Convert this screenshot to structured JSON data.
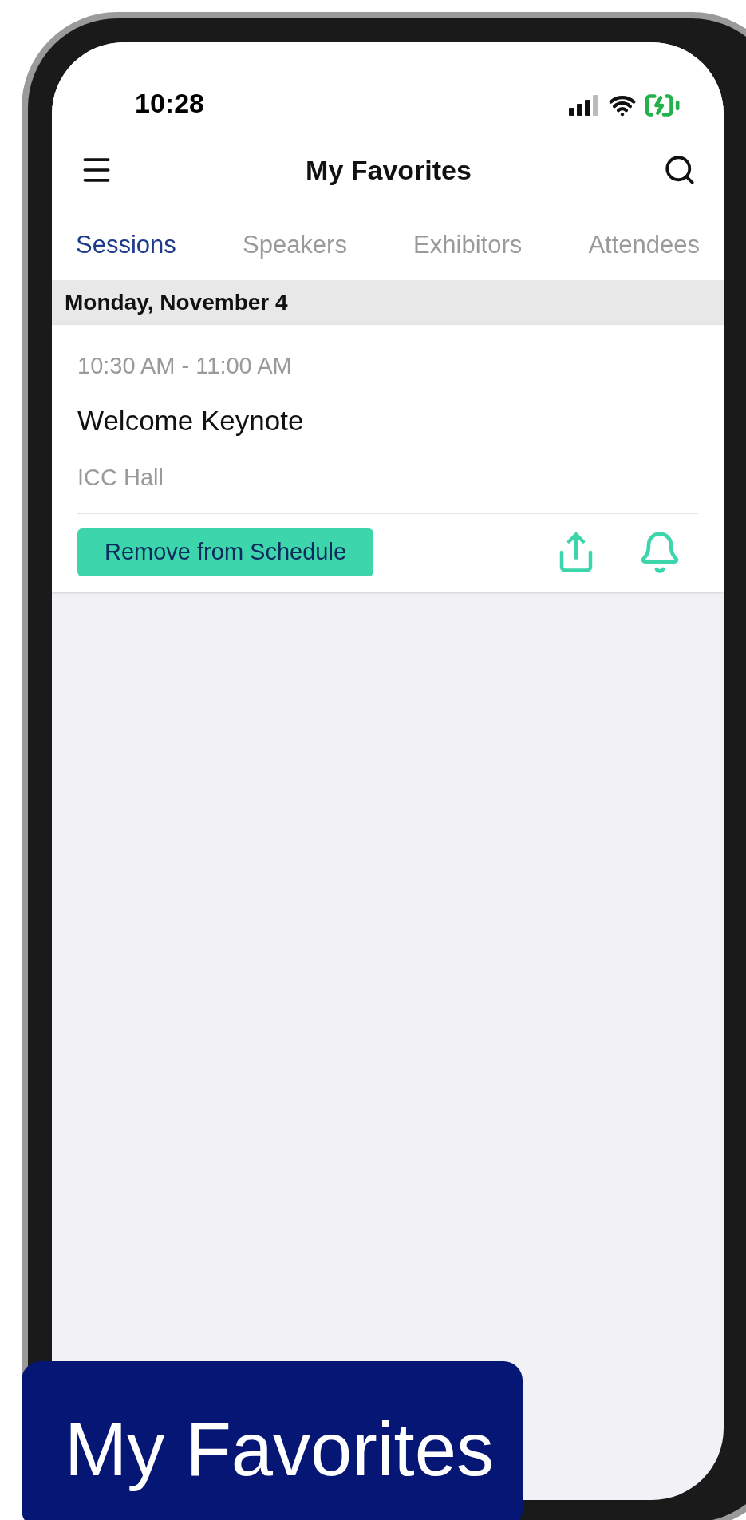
{
  "status_bar": {
    "time": "10:28"
  },
  "header": {
    "title": "My Favorites"
  },
  "tabs": [
    {
      "label": "Sessions",
      "selected": true
    },
    {
      "label": "Speakers",
      "selected": false
    },
    {
      "label": "Exhibitors",
      "selected": false
    },
    {
      "label": "Attendees",
      "selected": false
    }
  ],
  "sections": [
    {
      "date": "Monday, November 4",
      "sessions": [
        {
          "time": "10:30 AM - 11:00 AM",
          "title": "Welcome Keynote",
          "location": "ICC Hall",
          "action": "Remove from Schedule"
        }
      ]
    }
  ],
  "caption": "My Favorites"
}
